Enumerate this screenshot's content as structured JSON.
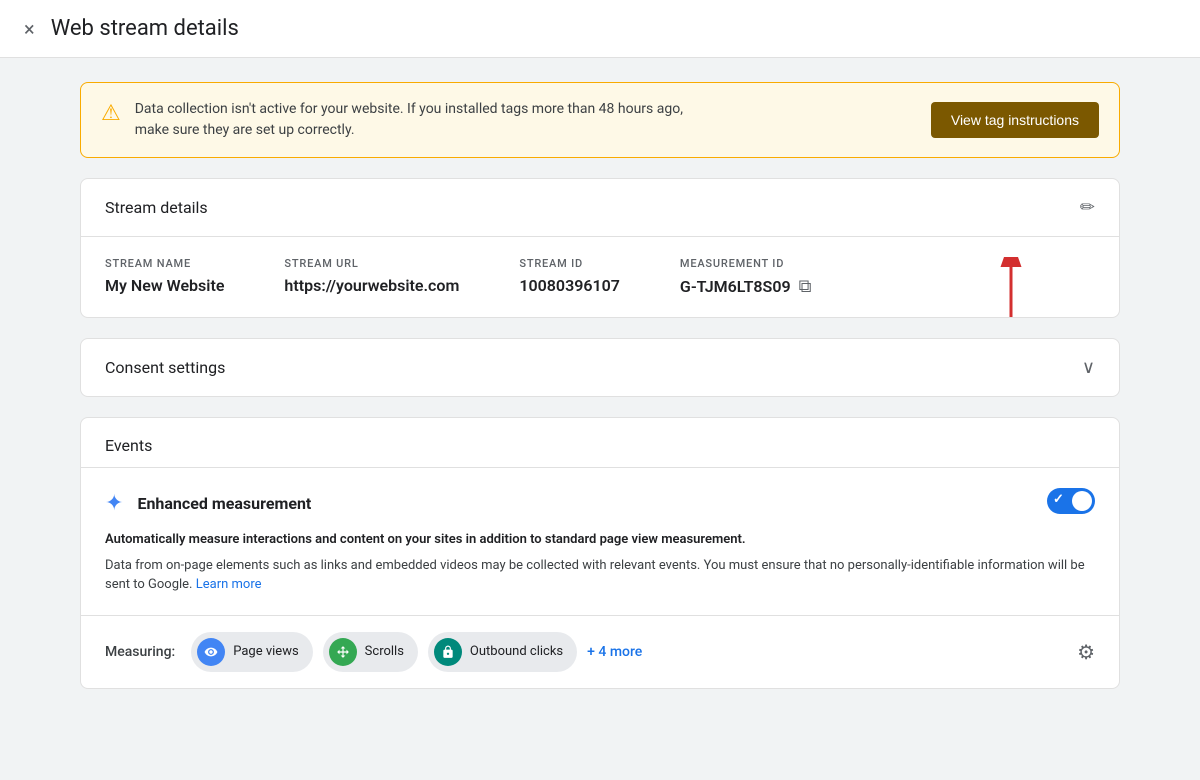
{
  "header": {
    "close_label": "×",
    "title": "Web stream details"
  },
  "warning": {
    "icon": "⚠",
    "text_line1": "Data collection isn't active for your website. If you installed tags more than 48 hours ago,",
    "text_line2": "make sure they are set up correctly.",
    "button_label": "View tag instructions"
  },
  "stream_details": {
    "section_title": "Stream details",
    "edit_icon": "✏",
    "fields": {
      "stream_name_label": "STREAM NAME",
      "stream_name_value": "My New Website",
      "stream_url_label": "STREAM URL",
      "stream_url_value": "https://yourwebsite.com",
      "stream_id_label": "STREAM ID",
      "stream_id_value": "10080396107",
      "measurement_id_label": "MEASUREMENT ID",
      "measurement_id_value": "G-TJM6LT8S09",
      "copy_icon": "⧉"
    }
  },
  "consent": {
    "section_title": "Consent settings",
    "chevron_icon": "∨"
  },
  "events": {
    "section_title": "Events",
    "enhanced": {
      "title": "Enhanced measurement",
      "desc": "Automatically measure interactions and content on your sites in addition to standard page view measurement.",
      "subdesc": "Data from on-page elements such as links and embedded videos may be collected with relevant events. You must ensure that no personally-identifiable information will be sent to Google.",
      "learn_more": "Learn more",
      "toggle_on": true
    },
    "measuring_label": "Measuring:",
    "chips": [
      {
        "label": "Page views",
        "icon": "👁",
        "color": "blue"
      },
      {
        "label": "Scrolls",
        "icon": "✦",
        "color": "green"
      },
      {
        "label": "Outbound clicks",
        "icon": "🔒",
        "color": "teal"
      }
    ],
    "more_label": "+ 4 more",
    "gear_icon": "⚙"
  }
}
